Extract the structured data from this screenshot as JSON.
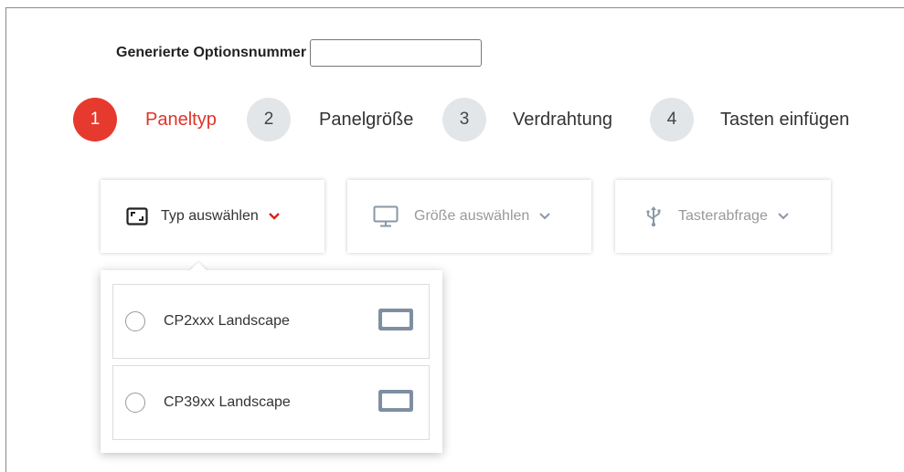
{
  "option_number": {
    "label": "Generierte Optionsnummer",
    "value": ""
  },
  "steps": [
    {
      "number": "1",
      "label": "Paneltyp",
      "active": true
    },
    {
      "number": "2",
      "label": "Panelgröße",
      "active": false
    },
    {
      "number": "3",
      "label": "Verdrahtung",
      "active": false
    },
    {
      "number": "4",
      "label": "Tasten einfügen",
      "active": false
    }
  ],
  "selectors": {
    "type": {
      "label": "Typ auswählen",
      "icon": "panel-frame-icon",
      "chevron_color": "#d9241c"
    },
    "size": {
      "label": "Größe auswählen",
      "icon": "monitor-icon"
    },
    "keys": {
      "label": "Tasterabfrage",
      "icon": "usb-icon"
    }
  },
  "dropdown": {
    "items": [
      {
        "label": "CP2xxx Landscape",
        "icon": "landscape-panel-icon"
      },
      {
        "label": "CP39xx Landscape",
        "icon": "landscape-panel-icon"
      }
    ]
  },
  "colors": {
    "accent": "#e63a2e",
    "step_inactive": "#e3e6e9"
  }
}
